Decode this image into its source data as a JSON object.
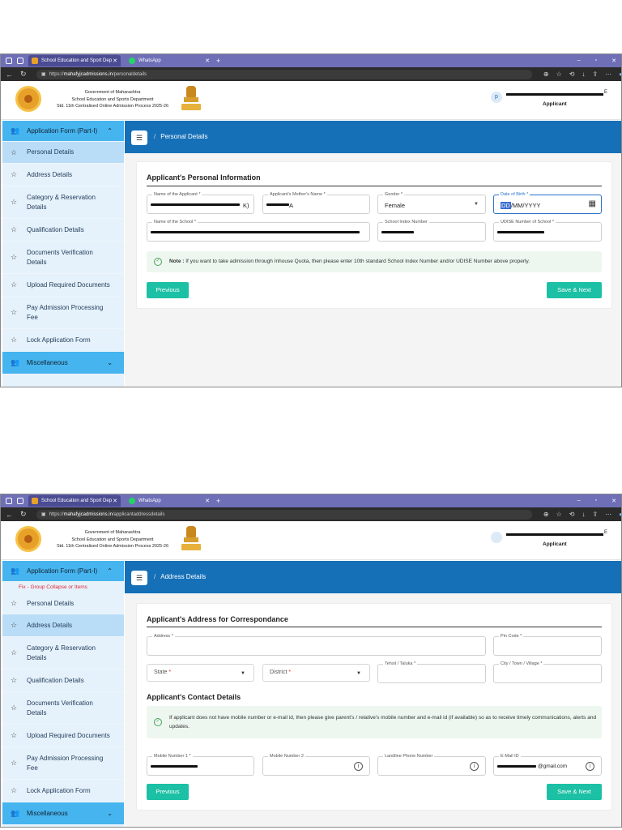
{
  "shot1": {
    "browser": {
      "tab1_title": "School Education and Sport Dep",
      "tab2_title": "WhatsApp",
      "url_prefix": "https://",
      "url_domain": "mahafyjcadmissions.in",
      "url_path": "/personaldetails"
    },
    "header": {
      "gov_line1": "Government of Maharashtra",
      "gov_line2": "School Education and Sports Department",
      "gov_line3": "Std. 11th Centralised Online Admission Process 2025-26",
      "avatar_letter": "p",
      "user_suffix": "E",
      "user_role": "Applicant"
    },
    "sidebar": {
      "parent": "Application Form (Part-I)",
      "items": [
        "Personal Details",
        "Address Details",
        "Category & Reservation Details",
        "Qualification Details",
        "Documents Verification Details",
        "Upload Required Documents",
        "Pay Admission Processing Fee",
        "Lock Application Form"
      ],
      "misc": "Miscellaneous"
    },
    "breadcrumb": "Personal Details",
    "section_title": "Applicant's Personal Information",
    "fields": {
      "applicant_name_label": "Name of the Applicant *",
      "applicant_name_tail": "K)",
      "mother_name_label": "Applicant's Mother's Name *",
      "mother_name_tail": "A",
      "gender_label": "Gender *",
      "gender_value": "Female",
      "dob_label": "Date of Birth *",
      "dob_sel": "DD",
      "dob_rest": "/MM/YYYY",
      "school_name_label": "Name of the School *",
      "school_index_label": "School Index Number",
      "udise_label": "UDISE Number of School *"
    },
    "note_bold": "Note :",
    "note_text": " If you want to take admission through Inhouse Quota, then please enter 10th standard School Index Number and/or UDISE Number above properly.",
    "prev_label": "Previous",
    "next_label": "Save & Next"
  },
  "shot2": {
    "browser": {
      "tab1_title": "School Education and Sport Dep",
      "tab2_title": "WhatsApp",
      "url_prefix": "https://",
      "url_domain": "mahafyjcadmissions.in",
      "url_path": "/applicantaddressdetails"
    },
    "header": {
      "gov_line1": "Government of Maharashtra",
      "gov_line2": "School Education and Sports Department",
      "gov_line3": "Std. 11th Centralised Online Admission Process 2025-26",
      "user_suffix": "E",
      "user_role": "Applicant"
    },
    "sidebar": {
      "parent": "Application Form (Part-I)",
      "note": "Fix - Group Collapse or Items",
      "items": [
        "Personal Details",
        "Address Details",
        "Category & Reservation Details",
        "Qualification Details",
        "Documents Verification Details",
        "Upload Required Documents",
        "Pay Admission Processing Fee",
        "Lock Application Form"
      ],
      "misc": "Miscellaneous"
    },
    "breadcrumb": "Address Details",
    "section_title": "Applicant's Address for Correspondance",
    "fields": {
      "address_label": "Address *",
      "pincode_label": "Pin Code *",
      "state_label": "State",
      "district_label": "District",
      "tehsil_label": "Tehsil / Taluka *",
      "city_label": "City / Town / Village *",
      "mobile1_label": "Mobile Number 1 *",
      "mobile2_label": "Mobile Number 2",
      "landline_label": "Landline Phone Number",
      "email_label": "E-Mail ID",
      "email_tail": "@gmail.com"
    },
    "contact_title": "Applicant's Contact Details",
    "note_text": "If applicant does not have mobile number or e-mail id, then please give parent's / relative's mobile number and e-mail id (if available) so as to receive timely communications, alerts and updates.",
    "prev_label": "Previous",
    "next_label": "Save & Next"
  }
}
